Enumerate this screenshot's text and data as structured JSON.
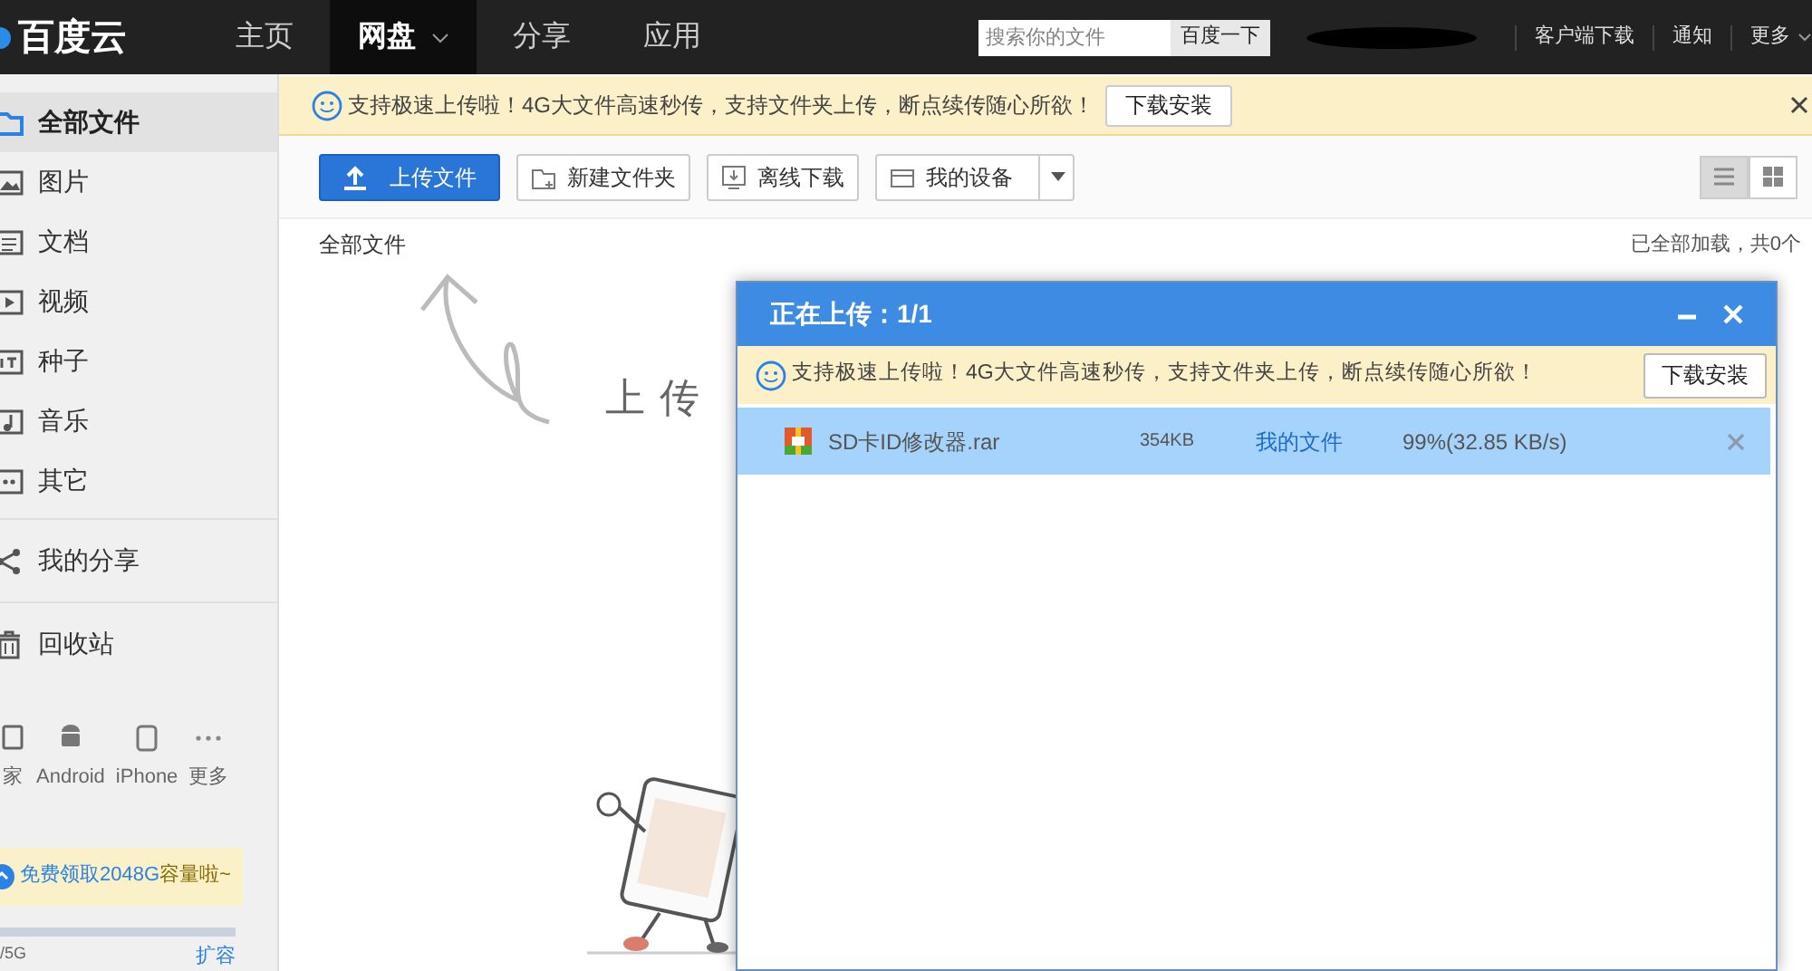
{
  "top_nav": {
    "logo": "百度云",
    "tabs": [
      {
        "label": "主页",
        "selected": false
      },
      {
        "label": "网盘",
        "selected": true
      },
      {
        "label": "分享",
        "selected": false
      },
      {
        "label": "应用",
        "selected": false
      }
    ],
    "search": {
      "placeholder": "搜索你的文件",
      "button": "百度一下"
    },
    "links": [
      "客户端下载",
      "通知",
      "更多"
    ]
  },
  "sidebar": {
    "items": [
      {
        "label": "全部文件",
        "kind": "all",
        "selected": true
      },
      {
        "label": "图片",
        "kind": "image",
        "selected": false
      },
      {
        "label": "文档",
        "kind": "doc",
        "selected": false
      },
      {
        "label": "视频",
        "kind": "video",
        "selected": false
      },
      {
        "label": "种子",
        "kind": "torrent",
        "selected": false
      },
      {
        "label": "音乐",
        "kind": "music",
        "selected": false
      },
      {
        "label": "其它",
        "kind": "other",
        "selected": false
      },
      {
        "label": "我的分享",
        "kind": "share",
        "selected": false
      },
      {
        "label": "回收站",
        "kind": "trash",
        "selected": false
      }
    ],
    "devices": [
      {
        "label": "家",
        "kind": "pc"
      },
      {
        "label": "Android",
        "kind": "android"
      },
      {
        "label": "iPhone",
        "kind": "phone"
      },
      {
        "label": "更多",
        "kind": "more"
      }
    ],
    "promo": "免费领取2048G**容量啦~**",
    "storage": {
      "used": "/5G",
      "action": "扩容"
    }
  },
  "notice": {
    "text": "支持极速上传啦！4G大文件高速秒传，支持文件夹上传，断点续传随心所欲！",
    "button": "下载安装"
  },
  "toolbar": {
    "buttons": [
      {
        "label": "上传文件",
        "kind": "upload"
      },
      {
        "label": "新建文件夹",
        "kind": "folder"
      },
      {
        "label": "离线下载",
        "kind": "offline"
      },
      {
        "label": "我的设备",
        "kind": "device"
      }
    ],
    "views": [
      {
        "kind": "list",
        "selected": true
      },
      {
        "kind": "grid",
        "selected": false
      }
    ]
  },
  "breadcrumb": "全部文件",
  "load_status": "已全部加载，共0个",
  "hint": "上传",
  "dialog": {
    "title": "正在上传：1/1",
    "notice": "支持极速上传啦！4G大文件高速秒传，支持文件夹上传，断点续传随心所欲！",
    "button": "下载安装",
    "rows": [
      {
        "name": "SD卡ID修改器.rar",
        "size": "354KB",
        "destination": "我的文件",
        "progress": "99%(32.85 KB/s)",
        "selected": true
      }
    ]
  }
}
